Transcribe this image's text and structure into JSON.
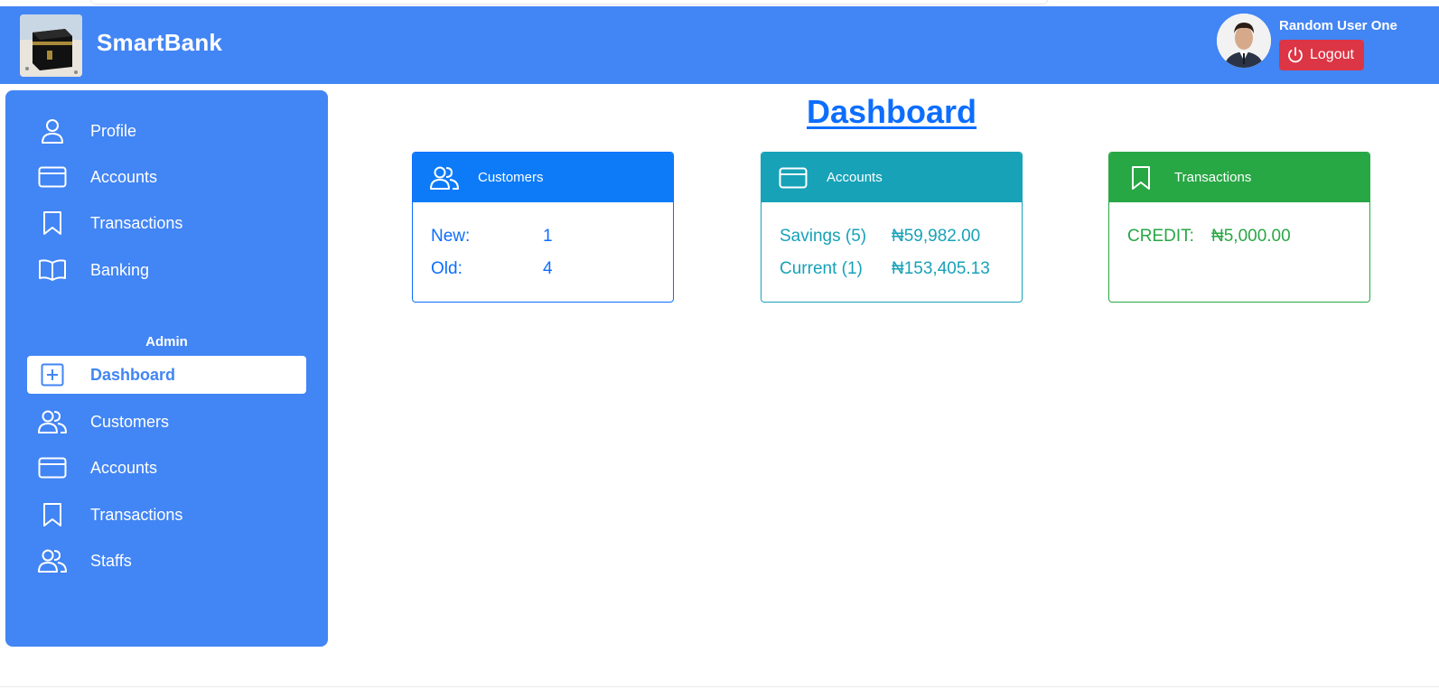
{
  "app": {
    "brand": "SmartBank"
  },
  "user": {
    "name": "Random User One",
    "logout_label": "Logout"
  },
  "sidebar": {
    "items": [
      {
        "label": "Profile",
        "icon": "person-icon"
      },
      {
        "label": "Accounts",
        "icon": "credit-card-icon"
      },
      {
        "label": "Transactions",
        "icon": "bookmark-icon"
      },
      {
        "label": "Banking",
        "icon": "book-icon"
      }
    ],
    "admin_heading": "Admin",
    "admin_items": [
      {
        "label": "Dashboard",
        "icon": "plus-square-icon",
        "active": true
      },
      {
        "label": "Customers",
        "icon": "people-icon"
      },
      {
        "label": "Accounts",
        "icon": "credit-card-icon"
      },
      {
        "label": "Transactions",
        "icon": "bookmark-icon"
      },
      {
        "label": "Staffs",
        "icon": "people-icon"
      }
    ]
  },
  "main": {
    "title": "Dashboard",
    "cards": {
      "customers": {
        "title": "Customers",
        "rows": [
          {
            "label": "New:",
            "value": "1"
          },
          {
            "label": "Old:",
            "value": "4"
          }
        ]
      },
      "accounts": {
        "title": "Accounts",
        "rows": [
          {
            "label": "Savings (5)",
            "value": "₦59,982.00"
          },
          {
            "label": "Current (1)",
            "value": "₦153,405.13"
          }
        ]
      },
      "transactions": {
        "title": "Transactions",
        "rows": [
          {
            "label": "CREDIT:",
            "value": "₦5,000.00"
          }
        ]
      }
    }
  },
  "colors": {
    "primary": "#4285f4",
    "blue": "#0d6efd",
    "teal": "#17a2b8",
    "green": "#28a745",
    "danger": "#dc3545"
  }
}
